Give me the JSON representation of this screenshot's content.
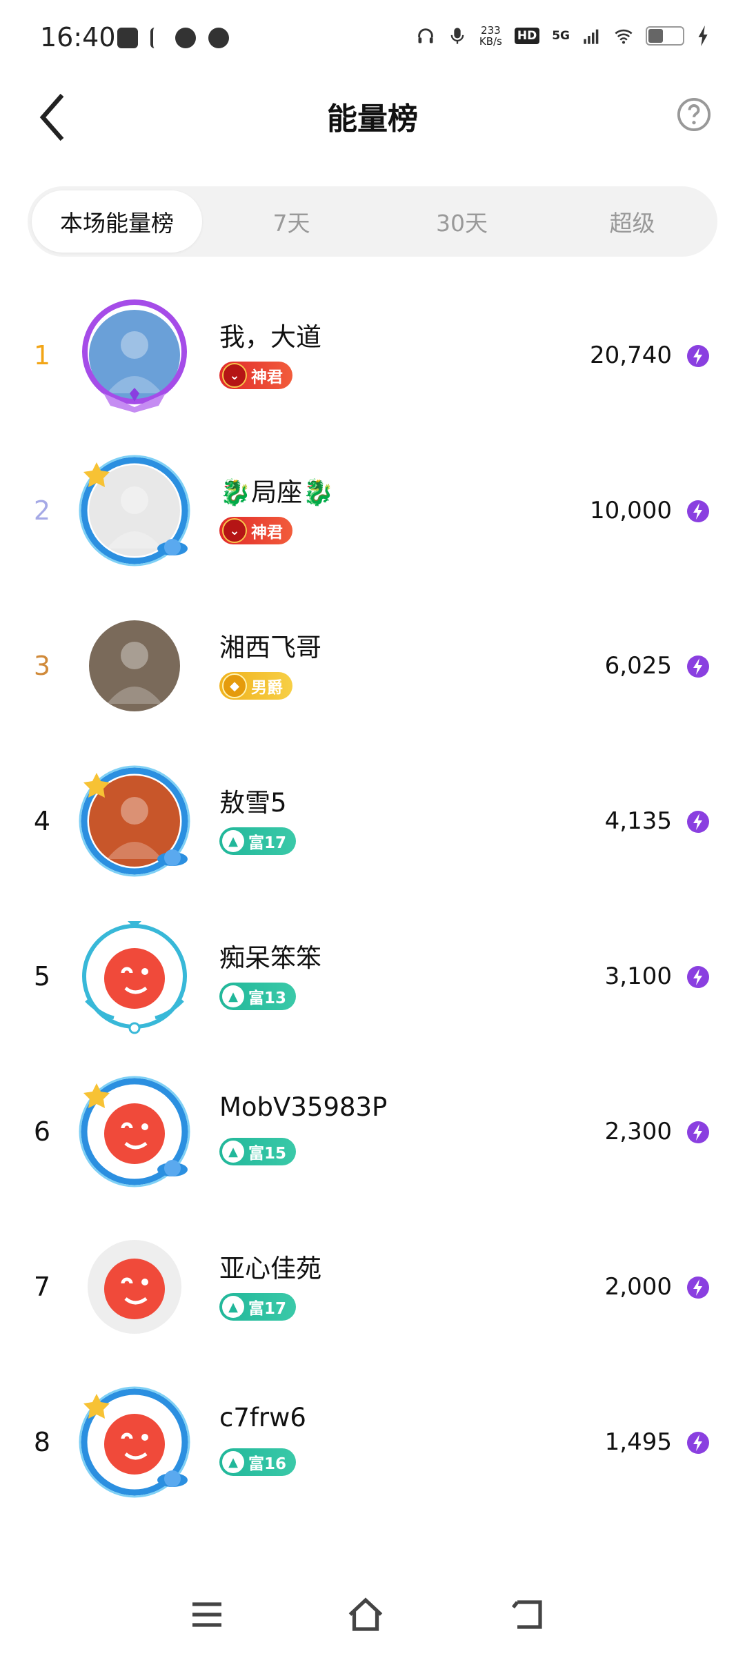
{
  "status_bar": {
    "time": "16:40",
    "speed_top": "233",
    "speed_unit": "KB/s",
    "hd": "HD",
    "network": "5G"
  },
  "header": {
    "title": "能量榜"
  },
  "tabs": [
    {
      "label": "本场能量榜",
      "active": true
    },
    {
      "label": "7天",
      "active": false
    },
    {
      "label": "30天",
      "active": false
    },
    {
      "label": "超级",
      "active": false
    }
  ],
  "ranking": [
    {
      "rank": "1",
      "name": "我，大道",
      "badge": "神君",
      "badge_style": "red",
      "energy": "20,740",
      "rank_color": "#f2a516"
    },
    {
      "rank": "2",
      "name": "🐉局座🐉",
      "badge": "神君",
      "badge_style": "red",
      "energy": "10,000",
      "rank_color": "#a5a9e6"
    },
    {
      "rank": "3",
      "name": "湘西飞哥",
      "badge": "男爵",
      "badge_style": "gold",
      "energy": "6,025",
      "rank_color": "#d08a3a"
    },
    {
      "rank": "4",
      "name": "敖雪5",
      "badge": "富17",
      "badge_style": "teal",
      "energy": "4,135",
      "rank_color": "#111111"
    },
    {
      "rank": "5",
      "name": "痴呆笨笨",
      "badge": "富13",
      "badge_style": "teal",
      "energy": "3,100",
      "rank_color": "#111111"
    },
    {
      "rank": "6",
      "name": "MobV35983P",
      "badge": "富15",
      "badge_style": "teal",
      "energy": "2,300",
      "rank_color": "#111111"
    },
    {
      "rank": "7",
      "name": "亚心佳苑",
      "badge": "富17",
      "badge_style": "teal",
      "energy": "2,000",
      "rank_color": "#111111"
    },
    {
      "rank": "8",
      "name": "c7frw6",
      "badge": "富16",
      "badge_style": "teal",
      "energy": "1,495",
      "rank_color": "#111111"
    }
  ],
  "colors": {
    "accent_purple": "#8a3fe0",
    "tab_bg": "#f2f2f2"
  }
}
